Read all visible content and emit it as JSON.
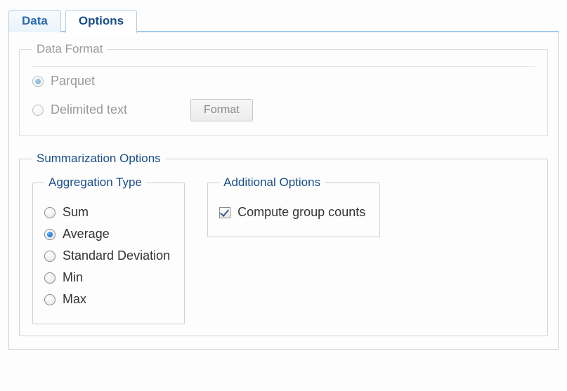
{
  "tabs": {
    "data": "Data",
    "options": "Options"
  },
  "dataFormat": {
    "legend": "Data Format",
    "parquet": "Parquet",
    "delimited": "Delimited text",
    "formatBtn": "Format"
  },
  "summarization": {
    "legend": "Summarization Options",
    "aggLegend": "Aggregation Type",
    "agg": {
      "sum": "Sum",
      "average": "Average",
      "stddev": "Standard Deviation",
      "min": "Min",
      "max": "Max"
    },
    "addlLegend": "Additional Options",
    "computeGroupCounts": "Compute group counts"
  }
}
